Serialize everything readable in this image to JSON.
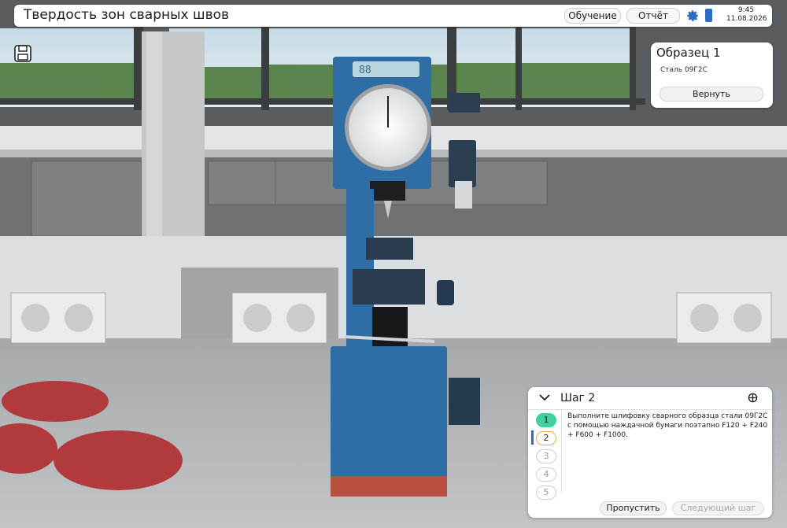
{
  "header": {
    "title": "Твердость зон сварных швов",
    "training_label": "Обучение",
    "report_label": "Отчёт",
    "time": "9:45",
    "date": "11.08.2026",
    "icons": [
      "gear-icon",
      "phone-icon"
    ]
  },
  "toolbar": {
    "save_icon": "save-icon"
  },
  "sample_panel": {
    "title": "Образец 1",
    "material": "Сталь 09Г2С",
    "return_label": "Вернуть"
  },
  "step_panel": {
    "title": "Шаг 2",
    "steps": [
      "1",
      "2",
      "3",
      "4",
      "5"
    ],
    "text": "Выполните шлифовку сварного образца стали 09Г2С с помощью наждачной бумаги поэтапно F120 + F240 + F600 + F1000.",
    "skip_label": "Пропустить",
    "next_label": "Следующий шаг"
  },
  "device": {
    "display": "88"
  },
  "colors": {
    "accent": "#2d6cc4",
    "done": "#3fd0a4",
    "machine": "#2f6da5"
  }
}
